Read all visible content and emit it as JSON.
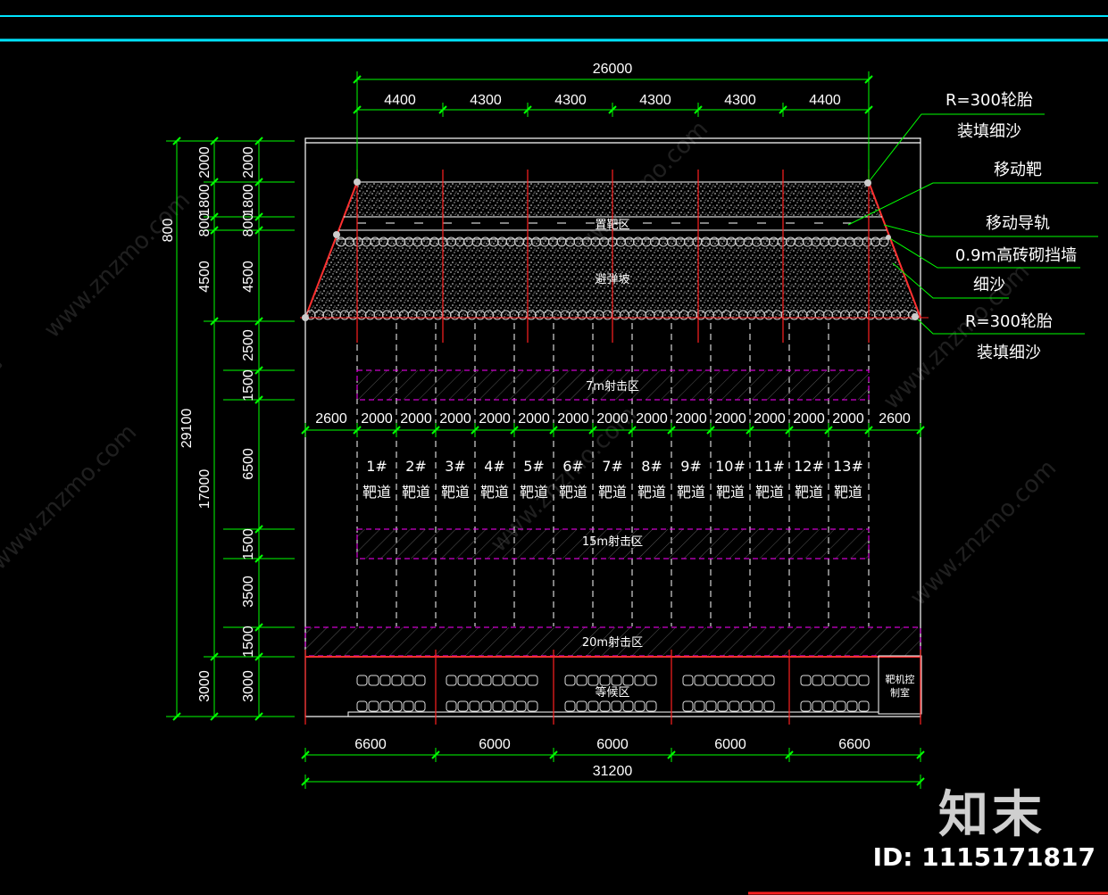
{
  "colors": {
    "background": "#000000",
    "dimension_line": "#00ff00",
    "outline": "#ffffff",
    "axis": "#ff2020",
    "zone_hatch": "#ff00ff",
    "header_bar": "#00e5ff"
  },
  "top_dimensions": {
    "overall": "26000",
    "segments": [
      "4400",
      "4300",
      "4300",
      "4300",
      "4300",
      "4400"
    ]
  },
  "lane_dimensions": [
    "2600",
    "2000",
    "2000",
    "2000",
    "2000",
    "2000",
    "2000",
    "2000",
    "2000",
    "2000",
    "2000",
    "2000",
    "2000",
    "2000",
    "2600"
  ],
  "bottom_dimensions": {
    "segments": [
      "6600",
      "6000",
      "6000",
      "6000",
      "6600"
    ],
    "overall": "31200"
  },
  "left_dimensions": {
    "overall": "29100",
    "outer": [
      "2000",
      "1800",
      "800",
      "4500",
      "17000",
      "3000"
    ],
    "outer_top": "800",
    "inner": [
      "2000",
      "1800",
      "800",
      "4500",
      "2500",
      "1500",
      "6500",
      "1500",
      "3500",
      "1500",
      "3000"
    ]
  },
  "zones": {
    "target_placement": "置靶区",
    "berm": "避弹坡",
    "range_7m": "7m射击区",
    "range_15m": "15m射击区",
    "range_20m": "20m射击区",
    "waiting": "等候区",
    "control_room_line1": "靶机控",
    "control_room_line2": "制室"
  },
  "lanes": {
    "numbers": [
      "1#",
      "2#",
      "3#",
      "4#",
      "5#",
      "6#",
      "7#",
      "8#",
      "9#",
      "10#",
      "11#",
      "12#",
      "13#"
    ],
    "label": "靶道"
  },
  "annotations": [
    "R=300轮胎",
    "装填细沙",
    "移动靶",
    "移动导轨",
    "0.9m高砖砌挡墙",
    "细沙",
    "R=300轮胎",
    "装填细沙"
  ],
  "watermark": {
    "domain": "www.znzmo.com",
    "brand": "知末网"
  },
  "brand_logo": "知末",
  "id_label": "ID: 1115171817"
}
